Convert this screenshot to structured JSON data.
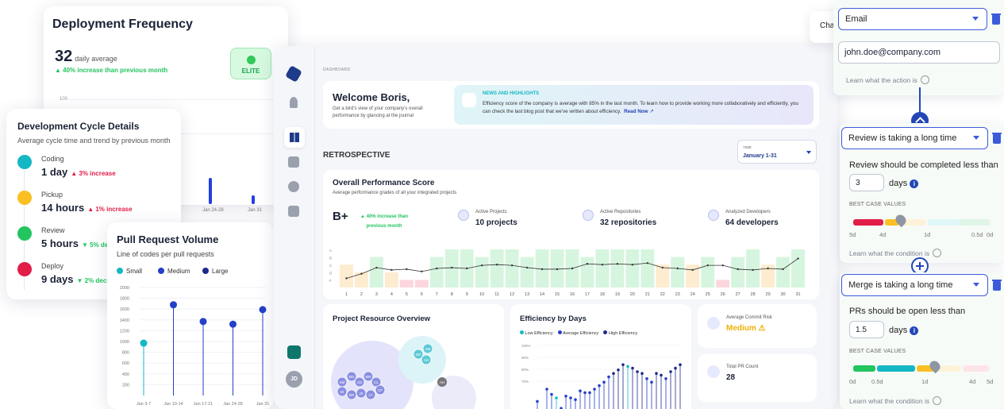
{
  "deployment": {
    "title": "Deployment Frequency",
    "value": "32",
    "unit": "daily average",
    "increase": "▲ 40% increase than previous month",
    "badge": "ELITE",
    "axis_top": "100",
    "tick_labels": [
      "Jan 24-28",
      "Jan 31"
    ]
  },
  "cycle": {
    "title": "Development Cycle Details",
    "subtitle": "Average cycle time and trend by previous month",
    "steps": [
      {
        "label": "Coding",
        "value": "1 day",
        "trend": "▲ 3% increase",
        "color": "#14b8c4",
        "trend_color": "#e11d48"
      },
      {
        "label": "Pickup",
        "value": "14 hours",
        "trend": "▲ 1% increase",
        "color": "#fbbf24",
        "trend_color": "#e11d48"
      },
      {
        "label": "Review",
        "value": "5 hours",
        "trend": "▼ 5% de",
        "color": "#22c55e",
        "trend_color": "#22c55e"
      },
      {
        "label": "Deploy",
        "value": "9 days",
        "trend": "▼ 2% decr",
        "color": "#e11d48",
        "trend_color": "#22c55e"
      }
    ]
  },
  "prv": {
    "title": "Pull Request Volume",
    "subtitle": "Line of codes per pull requests",
    "legend": [
      {
        "name": "Small",
        "color": "#14b8c4"
      },
      {
        "name": "Medium",
        "color": "#2340c8"
      },
      {
        "name": "Large",
        "color": "#1e2a8a"
      }
    ]
  },
  "chart_data": [
    {
      "type": "scatter",
      "title": "Pull Request Volume",
      "categories": [
        "Jan 3-7",
        "Jan 10-14",
        "Jan 17-21",
        "Jan 24-28",
        "Jan 31"
      ],
      "values": [
        970,
        1680,
        1370,
        1320,
        1590
      ],
      "point_colors": [
        "#14b8c4",
        "#2340c8",
        "#2340c8",
        "#2340c8",
        "#2340c8"
      ],
      "yticks": [
        200,
        400,
        600,
        800,
        1000,
        1200,
        1400,
        1600,
        1800,
        2000
      ],
      "ylim": [
        0,
        2000
      ]
    },
    {
      "type": "bar",
      "title": "Overall Performance Score",
      "categories": [
        1,
        2,
        3,
        4,
        5,
        6,
        7,
        8,
        9,
        10,
        11,
        12,
        13,
        14,
        15,
        16,
        17,
        18,
        19,
        20,
        21,
        22,
        23,
        24,
        25,
        26,
        27,
        28,
        29,
        30,
        31
      ],
      "values": [
        3,
        2,
        4,
        2,
        1,
        1,
        4,
        5,
        5,
        4,
        5,
        5,
        4,
        5,
        5,
        5,
        4,
        5,
        5,
        5,
        5,
        3,
        4,
        3,
        4,
        1,
        4,
        5,
        3,
        4,
        5
      ],
      "line_values": [
        1.2,
        1.8,
        2.6,
        2.3,
        2.4,
        2.1,
        2.5,
        2.6,
        2.5,
        2.9,
        3.0,
        2.9,
        2.6,
        2.4,
        2.4,
        2.5,
        3.1,
        3.0,
        3.1,
        3.0,
        3.2,
        2.6,
        2.5,
        2.3,
        2.9,
        2.9,
        2.4,
        2.3,
        2.5,
        2.4,
        3.8
      ],
      "ytick_labels": [
        "A",
        "B",
        "C",
        "D",
        "F"
      ]
    },
    {
      "type": "scatter",
      "title": "Efficiency by Days",
      "series": [
        {
          "name": "Low Efficiency",
          "color": "#14b8c4"
        },
        {
          "name": "Average Efficiency",
          "color": "#2340c8"
        },
        {
          "name": "High Efficiency",
          "color": "#1e2a8a"
        }
      ],
      "values": [
        68,
        62,
        75,
        72,
        70,
        64,
        71,
        70,
        69,
        74,
        73,
        73,
        75,
        77,
        79,
        82,
        84,
        86,
        89,
        88,
        87,
        85,
        84,
        81,
        79,
        84,
        83,
        81,
        85,
        87,
        89
      ],
      "yticks": [
        "100%",
        "90%",
        "80%",
        "70%"
      ]
    }
  ],
  "dashboard": {
    "breadcrumb": "DASHBOARD",
    "welcome_title": "Welcome Boris,",
    "welcome_text": "Get a bird's view of your company's overall performance by glancing at the journal",
    "news_title": "NEWS AND HIGHLIGHTS",
    "news_text": "Efficiency score of the company is average with 85% in the last month. To learn how to provide working more collaboratively and efficiently, you can check the last blog post that we've written about efficiency.",
    "news_link": "Read Now",
    "section": "RETROSPECTIVE",
    "time_label": "TIME",
    "time_value": "January 1-31",
    "ops_title": "Overall Performance Score",
    "ops_sub": "Average performance grades of all your integrated projects",
    "grade": "B+",
    "grade_inc": "▲ 40% increase than previous month",
    "stats": [
      {
        "label": "Active Projects",
        "value": "10 projects"
      },
      {
        "label": "Active Repositories",
        "value": "32 repositories"
      },
      {
        "label": "Analyzed Developers",
        "value": "64 developers"
      }
    ],
    "resource_title": "Project Resource Overview",
    "efficiency_title": "Efficiency by Days",
    "risk_label": "Average Commit Risk",
    "risk_value": "Medium",
    "pr_label": "Total PR Count",
    "pr_value": "28",
    "avatar": "JD",
    "bubbles": [
      "SM",
      "MS",
      "CD",
      "MR",
      "CL",
      "DI",
      "BR",
      "JK",
      "LT",
      "CF",
      "DR",
      "SM",
      "AH"
    ]
  },
  "workflow": {
    "partial_label": "Cha",
    "action_select": "Email",
    "email_value": "john.doe@company.com",
    "learn_action": "Learn what the action is",
    "cond1_select": "Review is taking a long time",
    "cond1_text": "Review should be completed less than",
    "cond1_value": "3",
    "days": "days",
    "best_case": "BEST CASE VALUES",
    "cond1_ticks": [
      "5d",
      "4d",
      "1d",
      "0.5d",
      "0d"
    ],
    "learn_condition": "Learn what the condition is",
    "cond2_select": "Merge is taking a long time",
    "cond2_text": "PRs should be open less than",
    "cond2_value": "1.5",
    "cond2_ticks": [
      "0d",
      "0.5d",
      "1d",
      "4d",
      "5d"
    ]
  }
}
